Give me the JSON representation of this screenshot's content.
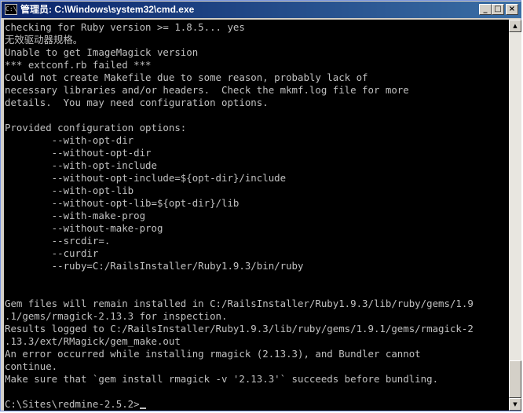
{
  "window": {
    "title": "管理员: C:\\Windows\\system32\\cmd.exe",
    "icon_label": "C:\\",
    "icons": {
      "app": "cmd-icon",
      "minimize": "minimize-icon",
      "maximize": "maximize-icon",
      "close": "close-icon"
    },
    "minimize_glyph": "_",
    "maximize_glyph": "□",
    "close_glyph": "×"
  },
  "colors": {
    "console_background": "#000000",
    "console_text": "#c0c0c0",
    "titlebar_start": "#0a246a",
    "titlebar_end": "#3a6ea5"
  },
  "console": {
    "lines": [
      "checking for Ruby version >= 1.8.5... yes",
      "无效驱动器规格。",
      "Unable to get ImageMagick version",
      "*** extconf.rb failed ***",
      "Could not create Makefile due to some reason, probably lack of",
      "necessary libraries and/or headers.  Check the mkmf.log file for more",
      "details.  You may need configuration options.",
      "",
      "Provided configuration options:",
      "        --with-opt-dir",
      "        --without-opt-dir",
      "        --with-opt-include",
      "        --without-opt-include=${opt-dir}/include",
      "        --with-opt-lib",
      "        --without-opt-lib=${opt-dir}/lib",
      "        --with-make-prog",
      "        --without-make-prog",
      "        --srcdir=.",
      "        --curdir",
      "        --ruby=C:/RailsInstaller/Ruby1.9.3/bin/ruby",
      "",
      "",
      "Gem files will remain installed in C:/RailsInstaller/Ruby1.9.3/lib/ruby/gems/1.9",
      ".1/gems/rmagick-2.13.3 for inspection.",
      "Results logged to C:/RailsInstaller/Ruby1.9.3/lib/ruby/gems/1.9.1/gems/rmagick-2",
      ".13.3/ext/RMagick/gem_make.out",
      "An error occurred while installing rmagick (2.13.3), and Bundler cannot",
      "continue.",
      "Make sure that `gem install rmagick -v '2.13.3'` succeeds before bundling.",
      ""
    ],
    "prompt": "C:\\Sites\\redmine-2.5.2>"
  },
  "scrollbar": {
    "up_glyph": "▲",
    "down_glyph": "▼",
    "position_fraction": 0.93
  }
}
